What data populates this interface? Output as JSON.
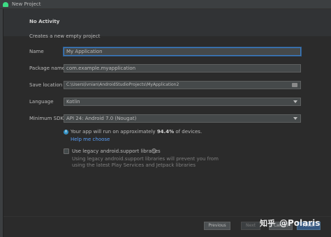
{
  "window": {
    "title": "New Project"
  },
  "header": {
    "title": "No Activity"
  },
  "subtitle": "Creates a new empty project",
  "form": {
    "name_label": "Name",
    "name_value": "My Application",
    "package_label": "Package name",
    "package_value": "com.example.myapplication",
    "save_label": "Save location",
    "save_value": "C:\\Users\\lvnian\\AndroidStudioProjects\\MyApplication2",
    "language_label": "Language",
    "language_value": "Kotlin",
    "min_sdk_label": "Minimum SDK",
    "min_sdk_value": "API 24: Android 7.0 (Nougat)"
  },
  "info": {
    "text_before": "Your app will run on approximately ",
    "percent": "94.4%",
    "text_after": " of devices.",
    "help_link": "Help me choose"
  },
  "legacy": {
    "checkbox_label": "Use legacy android.support libraries",
    "description": "Using legacy android.support libraries will prevent you from using the latest Play Services and Jetpack libraries"
  },
  "buttons": {
    "previous": "Previous",
    "next": "Next",
    "cancel": "Cancel",
    "finish": "Finish"
  },
  "watermark": {
    "logo": "知乎",
    "handle": "@Polaris"
  },
  "colors": {
    "accent": "#3d7bbf",
    "link": "#589df6",
    "info": "#3592c4",
    "android_green": "#3ddc84"
  }
}
